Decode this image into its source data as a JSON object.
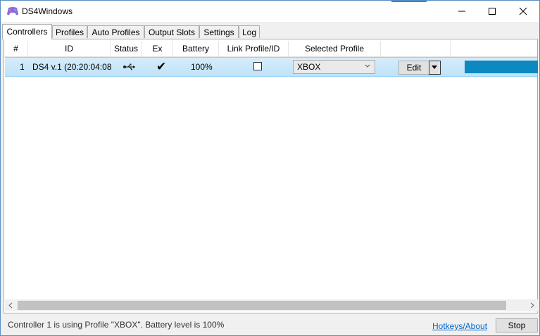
{
  "window": {
    "title": "DS4Windows",
    "minimize": "—",
    "maximize": "☐",
    "close": "✕"
  },
  "tabs": [
    {
      "label": "Controllers"
    },
    {
      "label": "Profiles"
    },
    {
      "label": "Auto Profiles"
    },
    {
      "label": "Output Slots"
    },
    {
      "label": "Settings"
    },
    {
      "label": "Log"
    }
  ],
  "grid": {
    "columns": [
      "#",
      "ID",
      "Status",
      "Ex",
      "Battery",
      "Link Profile/ID",
      "Selected Profile"
    ],
    "rows": [
      {
        "index": "1",
        "id": "DS4 v.1 (20:20:04:08:",
        "status_icon": "usb-icon",
        "exclusive": "✔",
        "battery": "100%",
        "link_profile": false,
        "selected_profile": "XBOX",
        "edit_label": "Edit",
        "lightbar_color": "#0b89c0"
      }
    ]
  },
  "statusbar": {
    "message": "Controller 1 is using Profile \"XBOX\". Battery level is 100%",
    "hotkeys_link": "Hotkeys/About",
    "stop_label": "Stop"
  },
  "colors": {
    "accent": "#1f8ee6",
    "row_selected": "#c7e6fa",
    "link": "#0066cc"
  }
}
